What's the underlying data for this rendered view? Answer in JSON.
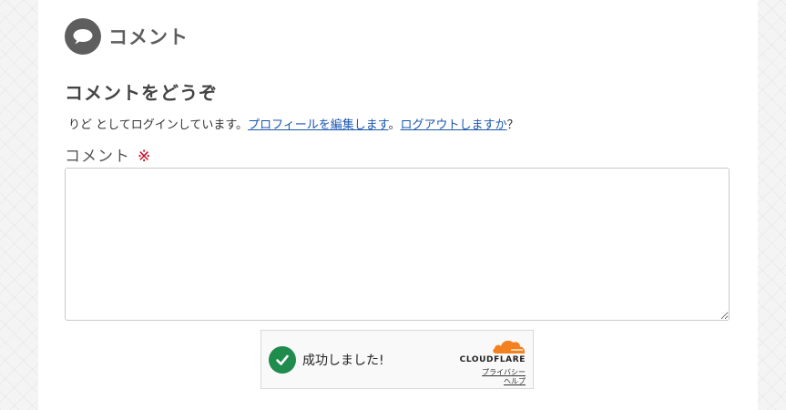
{
  "section": {
    "title": "コメント",
    "icon": "speech-bubble-icon"
  },
  "reply": {
    "title": "コメントをどうぞ",
    "logged_in_prefix": "りど としてログインしています。",
    "edit_profile_link": "プロフィールを編集します",
    "separator": "。",
    "logout_link": "ログアウトしますか",
    "suffix": "？"
  },
  "form": {
    "comment_label": "コメント",
    "required_mark": "※",
    "comment_value": ""
  },
  "turnstile": {
    "status_text": "成功しました!",
    "brand": "CLOUDFLARE",
    "privacy_link": "プライバシー",
    "help_link": "ヘルプ"
  },
  "colors": {
    "heading_gray": "#5e5e5e",
    "link_blue": "#1a56b0",
    "required_red": "#d0021b",
    "success_green": "#1f8b4c",
    "cloudflare_orange": "#f48120"
  }
}
